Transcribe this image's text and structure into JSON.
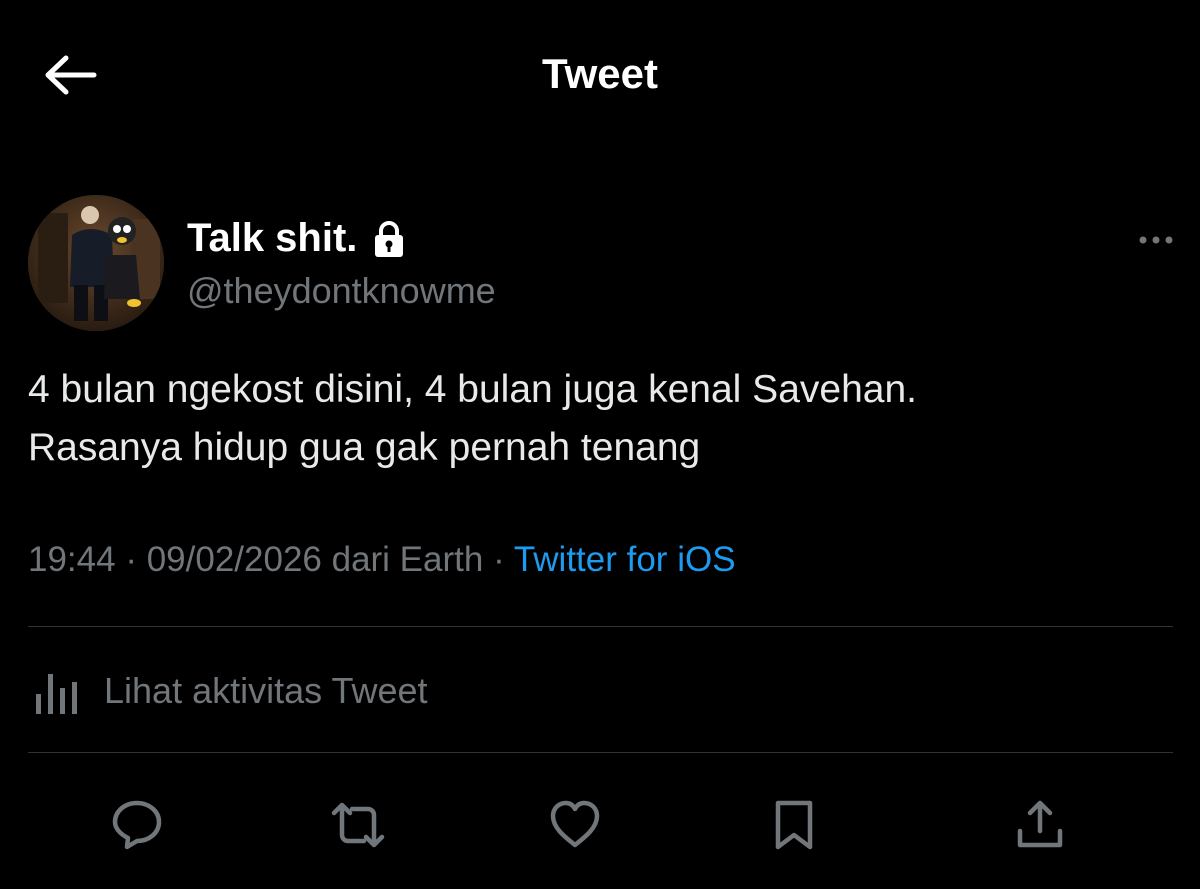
{
  "header": {
    "title": "Tweet",
    "back_icon": "arrow-left-icon"
  },
  "author": {
    "name": "Talk shit.",
    "handle": "@theydontknowme",
    "protected_icon": "lock-icon",
    "avatar_icon": "avatar"
  },
  "tweet": {
    "lines": [
      "4 bulan ngekost disini, 4 bulan juga kenal Savehan.",
      "Rasanya hidup gua gak pernah tenang"
    ]
  },
  "meta": {
    "time": "19:44",
    "separator": " · ",
    "date": "09/02/2026",
    "location_text": " dari Earth",
    "separator2": " · ",
    "source": "Twitter for iOS"
  },
  "activity": {
    "label": "Lihat aktivitas Tweet",
    "icon": "analytics-icon"
  },
  "actions": [
    {
      "name": "reply",
      "icon": "reply-icon"
    },
    {
      "name": "retweet",
      "icon": "retweet-icon"
    },
    {
      "name": "like",
      "icon": "heart-icon"
    },
    {
      "name": "bookmark",
      "icon": "bookmark-icon"
    },
    {
      "name": "share",
      "icon": "share-icon"
    }
  ],
  "colors": {
    "background": "#000000",
    "text_primary": "#e7e9ea",
    "text_secondary": "#71767b",
    "accent": "#1d9bf0",
    "divider": "#2f3336"
  }
}
